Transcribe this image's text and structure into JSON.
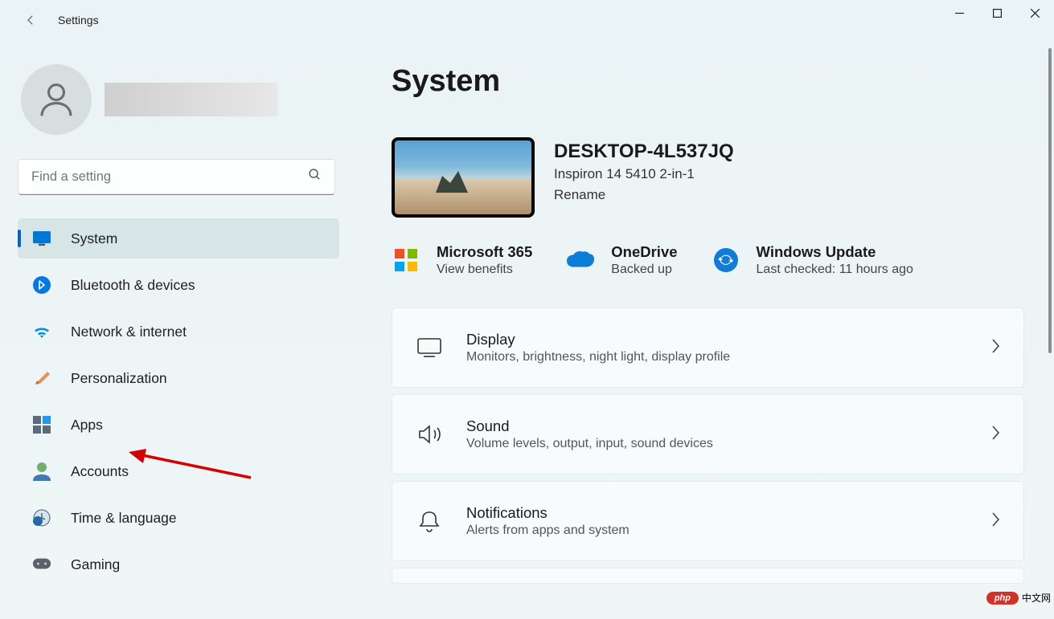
{
  "app_title": "Settings",
  "search_placeholder": "Find a setting",
  "nav": [
    {
      "label": "System",
      "icon": "display",
      "selected": true
    },
    {
      "label": "Bluetooth & devices",
      "icon": "bluetooth"
    },
    {
      "label": "Network & internet",
      "icon": "wifi"
    },
    {
      "label": "Personalization",
      "icon": "paint"
    },
    {
      "label": "Apps",
      "icon": "apps"
    },
    {
      "label": "Accounts",
      "icon": "person"
    },
    {
      "label": "Time & language",
      "icon": "clock"
    },
    {
      "label": "Gaming",
      "icon": "gamepad"
    }
  ],
  "page_heading": "System",
  "device": {
    "name": "DESKTOP-4L537JQ",
    "model": "Inspiron 14 5410 2-in-1",
    "rename": "Rename"
  },
  "status": [
    {
      "title": "Microsoft 365",
      "sub": "View benefits",
      "icon": "m365"
    },
    {
      "title": "OneDrive",
      "sub": "Backed up",
      "icon": "onedrive"
    },
    {
      "title": "Windows Update",
      "sub": "Last checked: 11 hours ago",
      "icon": "update"
    }
  ],
  "cards": [
    {
      "title": "Display",
      "sub": "Monitors, brightness, night light, display profile",
      "icon": "display"
    },
    {
      "title": "Sound",
      "sub": "Volume levels, output, input, sound devices",
      "icon": "sound"
    },
    {
      "title": "Notifications",
      "sub": "Alerts from apps and system",
      "icon": "bell"
    }
  ],
  "watermark": {
    "badge": "php",
    "text": "中文网"
  }
}
